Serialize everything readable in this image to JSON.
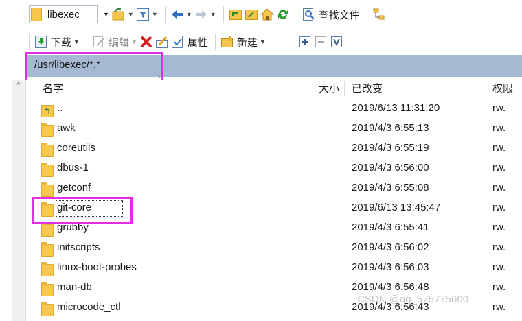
{
  "toolbar1": {
    "path_combo_value": "libexec",
    "find_files_label": "查找文件"
  },
  "toolbar2": {
    "download_label": "下载",
    "edit_label": "编辑",
    "properties_label": "属性",
    "new_label": "新建"
  },
  "path_bar": {
    "path": "/usr/libexec/*.*"
  },
  "columns": {
    "name": "名字",
    "size": "大小",
    "modified": "已改变",
    "permissions": "权限"
  },
  "files": [
    {
      "name": "..",
      "modified": "2019/6/13 11:31:20",
      "permissions": "rw.",
      "icon": "parent-folder-icon"
    },
    {
      "name": "awk",
      "modified": "2019/4/3 6:55:13",
      "permissions": "rw.",
      "icon": "folder-icon"
    },
    {
      "name": "coreutils",
      "modified": "2019/4/3 6:55:19",
      "permissions": "rw.",
      "icon": "folder-icon"
    },
    {
      "name": "dbus-1",
      "modified": "2019/4/3 6:56:00",
      "permissions": "rw.",
      "icon": "folder-icon"
    },
    {
      "name": "getconf",
      "modified": "2019/4/3 6:55:08",
      "permissions": "rw.",
      "icon": "folder-icon"
    },
    {
      "name": "git-core",
      "modified": "2019/6/13 13:45:47",
      "permissions": "rw.",
      "icon": "folder-icon"
    },
    {
      "name": "grubby",
      "modified": "2019/4/3 6:55:41",
      "permissions": "rw.",
      "icon": "folder-icon"
    },
    {
      "name": "initscripts",
      "modified": "2019/4/3 6:56:02",
      "permissions": "rw.",
      "icon": "folder-icon"
    },
    {
      "name": "linux-boot-probes",
      "modified": "2019/4/3 6:56:03",
      "permissions": "rw.",
      "icon": "folder-icon"
    },
    {
      "name": "man-db",
      "modified": "2019/4/3 6:56:48",
      "permissions": "rw.",
      "icon": "folder-icon"
    },
    {
      "name": "microcode_ctl",
      "modified": "2019/4/3 6:56:43",
      "permissions": "rw.",
      "icon": "folder-icon"
    }
  ],
  "watermark": "CSDN @qq_575775600",
  "colors": {
    "path_bar": "#a5b9d2",
    "highlight": "#e22ee2",
    "folder": "#f7c84e"
  }
}
